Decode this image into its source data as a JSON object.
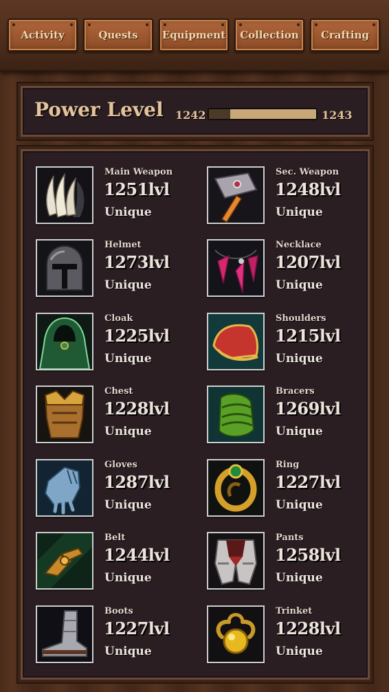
{
  "nav": {
    "tabs": [
      {
        "label": "Activity"
      },
      {
        "label": "Quests"
      },
      {
        "label": "Equipment"
      },
      {
        "label": "Collection"
      },
      {
        "label": "Crafting"
      }
    ]
  },
  "power": {
    "title": "Power Level",
    "current": "1242",
    "next": "1243",
    "progress": 0.2
  },
  "equipment": {
    "slots": [
      {
        "name": "Main Weapon",
        "level": "1251lvl",
        "rarity": "Unique",
        "icon": "claw-icon"
      },
      {
        "name": "Sec. Weapon",
        "level": "1248lvl",
        "rarity": "Unique",
        "icon": "hammer-icon"
      },
      {
        "name": "Helmet",
        "level": "1273lvl",
        "rarity": "Unique",
        "icon": "helmet-icon"
      },
      {
        "name": "Necklace",
        "level": "1207lvl",
        "rarity": "Unique",
        "icon": "necklace-icon"
      },
      {
        "name": "Cloak",
        "level": "1225lvl",
        "rarity": "Unique",
        "icon": "cloak-icon"
      },
      {
        "name": "Shoulders",
        "level": "1215lvl",
        "rarity": "Unique",
        "icon": "shoulders-icon"
      },
      {
        "name": "Chest",
        "level": "1228lvl",
        "rarity": "Unique",
        "icon": "chest-armor-icon"
      },
      {
        "name": "Bracers",
        "level": "1269lvl",
        "rarity": "Unique",
        "icon": "bracers-icon"
      },
      {
        "name": "Gloves",
        "level": "1287lvl",
        "rarity": "Unique",
        "icon": "gloves-icon"
      },
      {
        "name": "Ring",
        "level": "1227lvl",
        "rarity": "Unique",
        "icon": "ring-icon"
      },
      {
        "name": "Belt",
        "level": "1244lvl",
        "rarity": "Unique",
        "icon": "belt-icon"
      },
      {
        "name": "Pants",
        "level": "1258lvl",
        "rarity": "Unique",
        "icon": "pants-icon"
      },
      {
        "name": "Boots",
        "level": "1227lvl",
        "rarity": "Unique",
        "icon": "boots-icon"
      },
      {
        "name": "Trinket",
        "level": "1228lvl",
        "rarity": "Unique",
        "icon": "trinket-icon"
      }
    ]
  },
  "colors": {
    "accent_text": "#e3c49c",
    "tab_fill": "#a45c33",
    "panel_bg": "#2a1e22",
    "bar_track": "#c8a879",
    "bar_fill": "#4c3a29"
  }
}
